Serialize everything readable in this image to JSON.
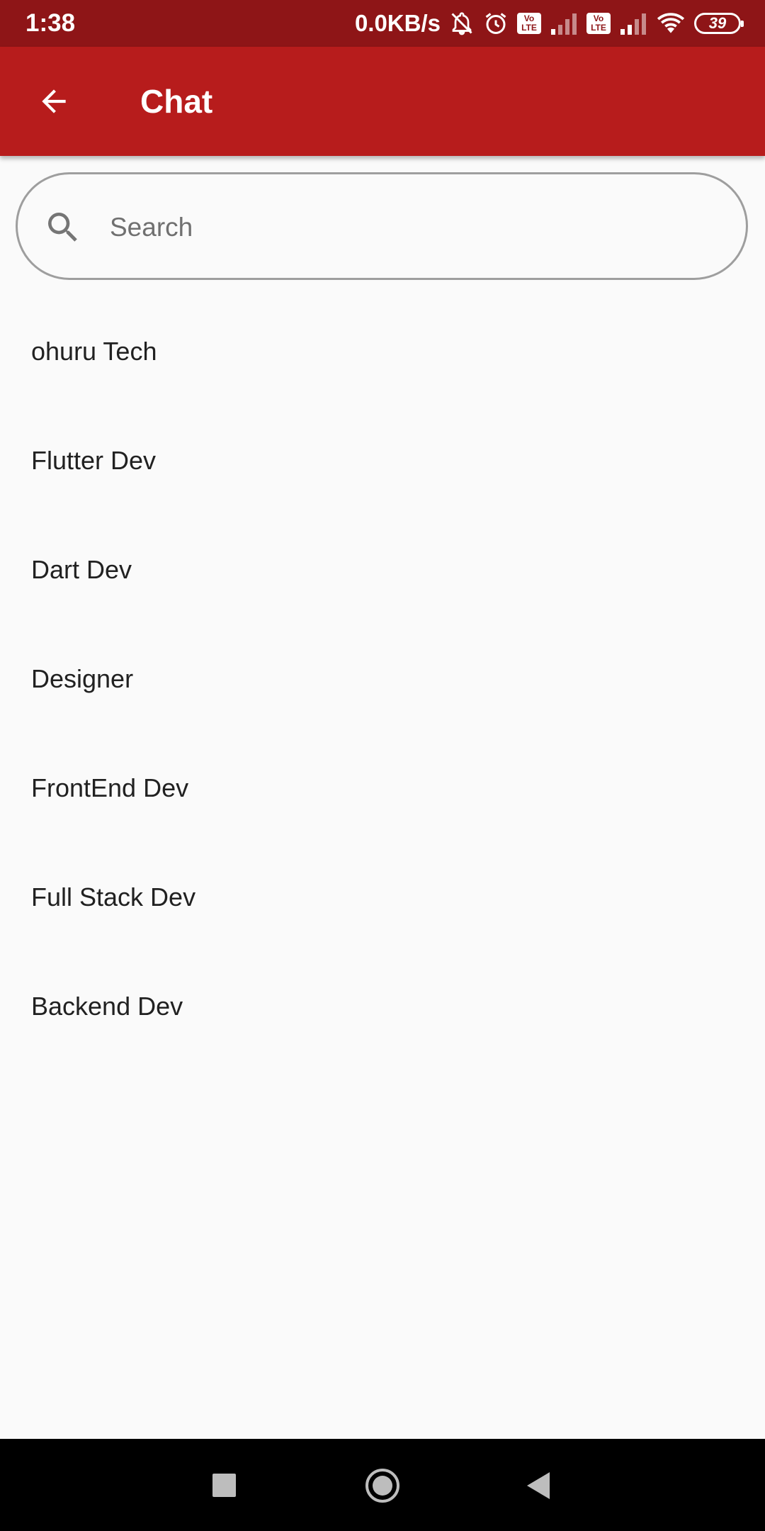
{
  "status_bar": {
    "time": "1:38",
    "net_speed": "0.0KB/s",
    "battery_level": "39",
    "lte_badge_1": "Vo\nLTE",
    "lte_badge_2": "Vo\nLTE",
    "icons": [
      "mute-icon",
      "alarm-icon",
      "volte-icon",
      "signal-icon",
      "volte-icon",
      "signal-icon",
      "wifi-icon",
      "battery-icon"
    ]
  },
  "app_bar": {
    "title": "Chat",
    "back_icon": "arrow-back-icon",
    "color": "#b71c1c"
  },
  "search": {
    "placeholder": "Search",
    "value": "",
    "icon": "search-icon"
  },
  "chats": [
    {
      "label": "ohuru Tech"
    },
    {
      "label": "Flutter Dev"
    },
    {
      "label": "Dart Dev"
    },
    {
      "label": "Designer"
    },
    {
      "label": "FrontEnd Dev"
    },
    {
      "label": "Full Stack Dev"
    },
    {
      "label": "Backend Dev"
    }
  ],
  "nav_bar": {
    "buttons": [
      "recents-icon",
      "home-icon",
      "back-triangle-icon"
    ]
  }
}
